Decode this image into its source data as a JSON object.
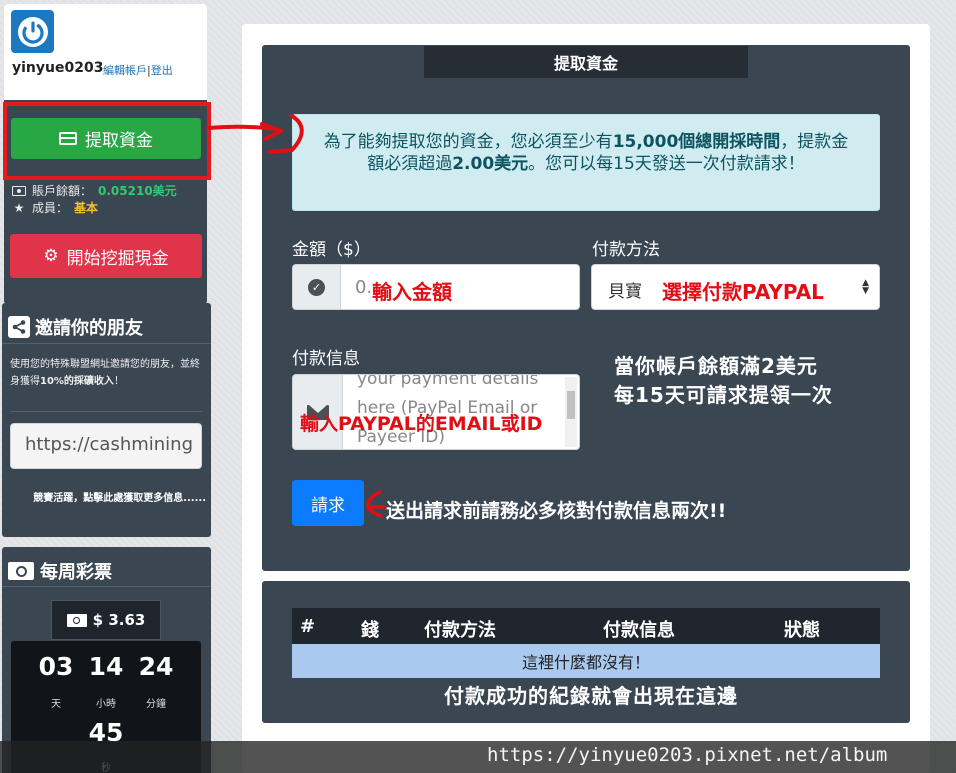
{
  "profile": {
    "username": "yinyue0203",
    "edit_account": "編輯帳戶",
    "separator": "|",
    "logout": "登出",
    "withdraw_button": "提取資金",
    "balance_label": "賬戶餘額：",
    "balance_value": "0.05210美元",
    "member_label": "成員：",
    "member_value": "基本",
    "mine_button": "開始挖掘現金"
  },
  "invite": {
    "title": "邀請你的朋友",
    "desc_prefix": "使用您的特殊聯盟網址邀請您的朋友，並終身獲得",
    "desc_bold": "10%的採礦收入",
    "desc_suffix": "！",
    "ref_url": "https://cashmining",
    "note": "競賽活躍，點擊此處獲取更多信息......"
  },
  "lottery": {
    "title": "每周彩票",
    "prize": "$ 3.63",
    "days": "03",
    "days_label": "天",
    "hours": "14",
    "hours_label": "小時",
    "minutes": "24",
    "minutes_label": "分鐘",
    "seconds": "45",
    "seconds_label": "秒"
  },
  "form": {
    "title": "提取資金",
    "info_1": "為了能夠提取您的資金，您必須至少有",
    "info_bold_1": "15,000個總開採時間",
    "info_2": "，提款金額必須超過",
    "info_bold_2": "2.00美元",
    "info_3": "。您可以每15天發送一次付款請求！",
    "amount_label": "金額（$）",
    "amount_value": "0.",
    "method_label": "付款方法",
    "method_value": "貝寶",
    "payinfo_label": "付款信息",
    "payinfo_placeholder": "your payment details here (PayPal Email or Payeer ID)",
    "request_button": "請求"
  },
  "history": {
    "columns": [
      "#",
      "錢",
      "付款方法",
      "付款信息",
      "狀態"
    ],
    "empty": "這裡什麼都沒有！"
  },
  "annotations": {
    "amount": "輸入金額",
    "method": "選擇付款PAYPAL",
    "payinfo": "輸入PAYPAL的EMAIL或ID",
    "rule_1": "當你帳戶餘額滿2美元",
    "rule_2": "每15天可請求提領一次",
    "check": "送出請求前請務必多核對付款信息兩次!!",
    "record": "付款成功的紀錄就會出現在這邊"
  },
  "watermark": "https://yinyue0203.pixnet.net/album",
  "colors": {
    "sidebar_bg": "#3b4653",
    "success": "#28a745",
    "danger": "#e0344a",
    "primary": "#0b7bff",
    "annotation_red": "#e10e15"
  }
}
